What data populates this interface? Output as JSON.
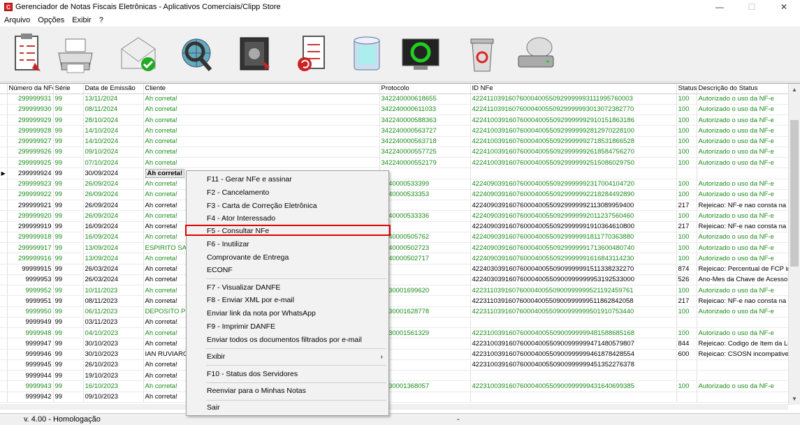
{
  "window": {
    "title": "Gerenciador de Notas Fiscais Eletrônicas - Aplicativos Comerciais/Clipp Store",
    "minimize": "—",
    "maximize": "☐",
    "close": "✕"
  },
  "menu": [
    "Arquivo",
    "Opções",
    "Exibir",
    "?"
  ],
  "toolbar": {
    "buttons": [
      "checklist-icon",
      "printer-icon",
      "email-icon",
      "search-globe-icon",
      "safe-icon",
      "checklist-refresh-icon",
      "database-icon",
      "monitor-sync-icon",
      "recycle-bin-icon",
      "disk-drive-icon"
    ]
  },
  "colors": {
    "green_text": "#1a8c1a",
    "highlight_border": "#e00000"
  },
  "grid": {
    "headers": [
      "Número da NFe",
      "Série",
      "Data de Emissão",
      "Cliente",
      "Protocolo",
      "ID NFe",
      "Status",
      "Descrição do Status"
    ],
    "rows": [
      {
        "c": "green",
        "ind": "",
        "num": "299999931",
        "serie": "99",
        "data": "13/11/2024",
        "cliente": "Ah correta!",
        "prot": "342240000618655",
        "id": "42241103916076000400550929999993111995760003",
        "st": "100",
        "desc": "Autorizado o uso da NF-e"
      },
      {
        "c": "green",
        "ind": "",
        "num": "299999930",
        "serie": "99",
        "data": "08/11/2024",
        "cliente": "Ah correta!",
        "prot": "342240000611033",
        "id": "42241103916076000400550929999993013072382770",
        "st": "100",
        "desc": "Autorizado o uso da NF-e"
      },
      {
        "c": "green",
        "ind": "",
        "num": "299999929",
        "serie": "99",
        "data": "28/10/2024",
        "cliente": "Ah correta!",
        "prot": "342240000588363",
        "id": "42241003916076000400550929999992910151863186",
        "st": "100",
        "desc": "Autorizado o uso da NF-e"
      },
      {
        "c": "green",
        "ind": "",
        "num": "299999928",
        "serie": "99",
        "data": "14/10/2024",
        "cliente": "Ah correta!",
        "prot": "342240000563727",
        "id": "42241003916076000400550929999992812970228100",
        "st": "100",
        "desc": "Autorizado o uso da NF-e"
      },
      {
        "c": "green",
        "ind": "",
        "num": "299999927",
        "serie": "99",
        "data": "14/10/2024",
        "cliente": "Ah correta!",
        "prot": "342240000563718",
        "id": "42241003916076000400550929999992718531866528",
        "st": "100",
        "desc": "Autorizado o uso da NF-e"
      },
      {
        "c": "green",
        "ind": "",
        "num": "299999926",
        "serie": "99",
        "data": "09/10/2024",
        "cliente": "Ah correta!",
        "prot": "342240000557725",
        "id": "42241003916076000400550929999992618584756270",
        "st": "100",
        "desc": "Autorizado o uso da NF-e"
      },
      {
        "c": "green",
        "ind": "",
        "num": "299999925",
        "serie": "99",
        "data": "07/10/2024",
        "cliente": "Ah correta!",
        "prot": "342240000552179",
        "id": "42241003916076000400550929999992515086029750",
        "st": "100",
        "desc": "Autorizado o uso da NF-e"
      },
      {
        "c": "black",
        "ind": "▶",
        "num": "299999924",
        "serie": "99",
        "data": "30/09/2024",
        "cliente": "Ah correta!",
        "prot": "",
        "id": "",
        "st": "",
        "desc": "",
        "selected": true
      },
      {
        "c": "green",
        "ind": "",
        "num": "299999923",
        "serie": "99",
        "data": "26/09/2024",
        "cliente": "Ah correta!",
        "prot": "2240000533399",
        "id": "42240903916076000400550929999992317004104720",
        "st": "100",
        "desc": "Autorizado o uso da NF-e"
      },
      {
        "c": "green",
        "ind": "",
        "num": "299999922",
        "serie": "99",
        "data": "26/09/2024",
        "cliente": "Ah correta!",
        "prot": "2240000533353",
        "id": "42240903916076000400550929999992218284492890",
        "st": "100",
        "desc": "Autorizado o uso da NF-e"
      },
      {
        "c": "black",
        "ind": "",
        "num": "299999921",
        "serie": "99",
        "data": "26/09/2024",
        "cliente": "Ah correta!",
        "prot": "",
        "id": "42240903916076000400550929999992113089959400",
        "st": "217",
        "desc": "Rejeicao: NF-e nao consta na b"
      },
      {
        "c": "green",
        "ind": "",
        "num": "299999920",
        "serie": "99",
        "data": "26/09/2024",
        "cliente": "Ah correta!",
        "prot": "2240000533336",
        "id": "42240903916076000400550929999992011237560460",
        "st": "100",
        "desc": "Autorizado o uso da NF-e"
      },
      {
        "c": "black",
        "ind": "",
        "num": "299999919",
        "serie": "99",
        "data": "16/09/2024",
        "cliente": "Ah correta!",
        "prot": "",
        "id": "42240903916076000400550929999991910364610800",
        "st": "217",
        "desc": "Rejeicao: NF-e nao consta na b"
      },
      {
        "c": "green",
        "ind": "",
        "num": "299999918",
        "serie": "99",
        "data": "16/09/2024",
        "cliente": "Ah correta!",
        "prot": "2240000505762",
        "id": "42240903916076000400550929999991811770363880",
        "st": "100",
        "desc": "Autorizado o uso da NF-e"
      },
      {
        "c": "green",
        "ind": "",
        "num": "299999917",
        "serie": "99",
        "data": "13/09/2024",
        "cliente": "ESPIRITO SAN",
        "prot": "2240000502723",
        "id": "42240903916076000400550929999991713600480740",
        "st": "100",
        "desc": "Autorizado o uso da NF-e"
      },
      {
        "c": "green",
        "ind": "",
        "num": "299999916",
        "serie": "99",
        "data": "13/09/2024",
        "cliente": "Ah correta!",
        "prot": "2240000502717",
        "id": "42240903916076000400550929999991616843114230",
        "st": "100",
        "desc": "Autorizado o uso da NF-e"
      },
      {
        "c": "black",
        "ind": "",
        "num": "99999915",
        "serie": "99",
        "data": "26/03/2024",
        "cliente": "Ah correta!",
        "prot": "",
        "id": "42240303916076000400550909999991511338232270",
        "st": "874",
        "desc": "Rejeicao: Percentual de FCP in"
      },
      {
        "c": "black",
        "ind": "",
        "num": "9999953",
        "serie": "99",
        "data": "26/03/2024",
        "cliente": "Ah correta!",
        "prot": "",
        "id": "42240303916076000400550900999999953192533000",
        "st": "526",
        "desc": "Ano-Mes da Chave de Acesso c"
      },
      {
        "c": "green",
        "ind": "",
        "num": "9999952",
        "serie": "99",
        "data": "10/11/2023",
        "cliente": "Ah correta!",
        "prot": "2230001699620",
        "id": "42231103916076000400550900999999521192459761",
        "st": "100",
        "desc": "Autorizado o uso da NF-e"
      },
      {
        "c": "black",
        "ind": "",
        "num": "9999951",
        "serie": "99",
        "data": "08/11/2023",
        "cliente": "Ah correta!",
        "prot": "",
        "id": "42231103916076000400550900999999511862842058",
        "st": "217",
        "desc": "Rejeicao: NF-e nao consta na b"
      },
      {
        "c": "green",
        "ind": "",
        "num": "9999950",
        "serie": "99",
        "data": "06/11/2023",
        "cliente": "DEPOSITO PE",
        "prot": "2230001628778",
        "id": "42231103916076000400550900999999501910753440",
        "st": "100",
        "desc": "Autorizado o uso da NF-e"
      },
      {
        "c": "black",
        "ind": "",
        "num": "9999949",
        "serie": "99",
        "data": "03/11/2023",
        "cliente": "Ah correta!",
        "prot": "",
        "id": "",
        "st": "",
        "desc": ""
      },
      {
        "c": "green",
        "ind": "",
        "num": "9999948",
        "serie": "99",
        "data": "04/10/2023",
        "cliente": "Ah correta!",
        "prot": "2230001561329",
        "id": "42231003916076000400550900999999481588685168",
        "st": "100",
        "desc": "Autorizado o uso da NF-e"
      },
      {
        "c": "black",
        "ind": "",
        "num": "9999947",
        "serie": "99",
        "data": "30/10/2023",
        "cliente": "Ah correta!",
        "prot": "",
        "id": "42231003916076000400550900999999471480579807",
        "st": "844",
        "desc": "Rejeicao: Codigo de Item da Lis"
      },
      {
        "c": "black",
        "ind": "",
        "num": "9999946",
        "serie": "99",
        "data": "30/10/2023",
        "cliente": "IAN RUVIARO",
        "prot": "",
        "id": "42231003916076000400550900999999461878428554",
        "st": "600",
        "desc": "Rejeicao: CSOSN incompativel"
      },
      {
        "c": "black",
        "ind": "",
        "num": "9999945",
        "serie": "99",
        "data": "26/10/2023",
        "cliente": "Ah correta!",
        "prot": "",
        "id": "42231003916076000400550900999999451352276378",
        "st": "",
        "desc": ""
      },
      {
        "c": "black",
        "ind": "",
        "num": "9999944",
        "serie": "99",
        "data": "19/10/2023",
        "cliente": "Ah correta!",
        "prot": "",
        "id": "",
        "st": "",
        "desc": ""
      },
      {
        "c": "green",
        "ind": "",
        "num": "9999943",
        "serie": "99",
        "data": "16/10/2023",
        "cliente": "Ah correta!",
        "prot": "2230001368057",
        "id": "42231003916076000400550900999999431640699385",
        "st": "100",
        "desc": "Autorizado o uso da NF-e"
      },
      {
        "c": "black",
        "ind": "",
        "num": "9999942",
        "serie": "99",
        "data": "09/10/2023",
        "cliente": "Ah correta!",
        "prot": "",
        "id": "",
        "st": "",
        "desc": ""
      }
    ]
  },
  "context_menu": {
    "items": [
      "F11 - Gerar NFe e assinar",
      "F2 - Cancelamento",
      "F3 - Carta de Correção Eletrônica",
      "F4 - Ator Interessado",
      "F5 - Consultar NFe",
      "F6 - Inutilizar",
      "Comprovante de Entrega",
      "ECONF",
      "F7 - Visualizar DANFE",
      "F8 - Enviar XML por e-mail",
      "Enviar link da nota por WhatsApp",
      "F9 - Imprimir DANFE",
      "Enviar todos os documentos filtrados por e-mail",
      "Exibir",
      "F10 - Status dos Servidores",
      "Reenviar para o Minhas Notas",
      "Sair"
    ],
    "submenu_arrow": "›"
  },
  "status": {
    "version": "v. 4.00 - Homologação",
    "sep": "-"
  }
}
